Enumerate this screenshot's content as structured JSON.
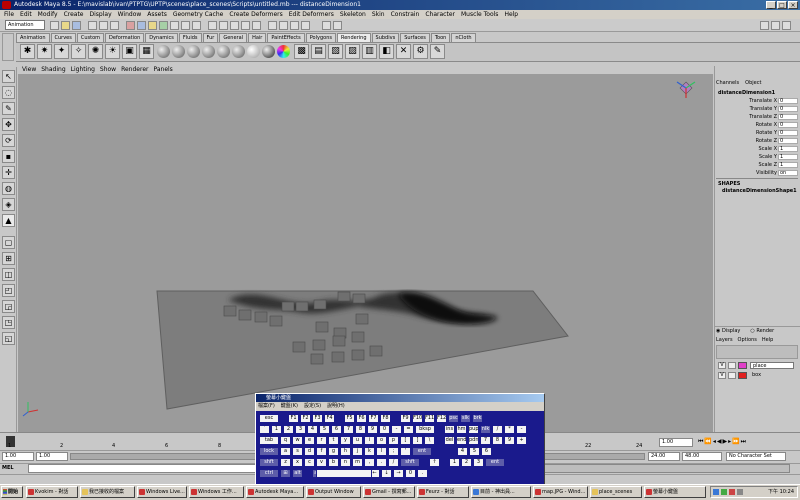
{
  "window": {
    "title": "Autodesk Maya 8.5 - E:\\mavislab\\ivan\\PTPTG\\UPTP\\scenes\\place_scenes\\Scripts\\untitled.mb  ---  distanceDimension1",
    "min": "_",
    "max": "□",
    "close": "×"
  },
  "menubar": [
    "File",
    "Edit",
    "Modify",
    "Create",
    "Display",
    "Window",
    "Assets",
    "Geometry Cache",
    "Create Deformers",
    "Edit Deformers",
    "Skeleton",
    "Skin",
    "Constrain",
    "Character",
    "Muscle Tools",
    "Help"
  ],
  "status_line": {
    "mode": "Animation"
  },
  "shelf": {
    "tabs": [
      "Animation",
      "Curves",
      "Custom",
      "Deformation",
      "Dynamics",
      "Fluids",
      "Fur",
      "General",
      "Hair",
      "PaintEffects",
      "Polygons",
      "Rendering",
      "Subdivs",
      "Surfaces",
      "Toon",
      "nCloth"
    ],
    "active_tab": "Rendering"
  },
  "panel_menu": [
    "View",
    "Shading",
    "Lighting",
    "Show",
    "Renderer",
    "Panels"
  ],
  "channel_box": {
    "tabs": [
      "Channels",
      "Object"
    ],
    "object": "distanceDimension1",
    "attributes": [
      {
        "label": "Translate X",
        "value": "0"
      },
      {
        "label": "Translate Y",
        "value": "0"
      },
      {
        "label": "Translate Z",
        "value": "0"
      },
      {
        "label": "Rotate X",
        "value": "0"
      },
      {
        "label": "Rotate Y",
        "value": "0"
      },
      {
        "label": "Rotate Z",
        "value": "0"
      },
      {
        "label": "Scale X",
        "value": "1"
      },
      {
        "label": "Scale Y",
        "value": "1"
      },
      {
        "label": "Scale Z",
        "value": "1"
      },
      {
        "label": "Visibility",
        "value": "on"
      }
    ],
    "shapes_header": "SHAPES",
    "shape_name": "distanceDimensionShape1"
  },
  "layer_editor": {
    "mode_display": "Display",
    "mode_render": "Render",
    "menu": [
      "Layers",
      "Options",
      "Help"
    ],
    "layers": [
      {
        "visible": "V",
        "name": "place",
        "color": "#e040c8"
      },
      {
        "visible": "V",
        "name": "box",
        "color": "#e02020"
      }
    ]
  },
  "time_slider": {
    "current_frame": "1.00",
    "tick_labels": [
      "1",
      "2",
      "4",
      "6",
      "8",
      "10",
      "12",
      "14",
      "16",
      "18",
      "20",
      "22",
      "24"
    ]
  },
  "range_slider": {
    "start": "1.00",
    "inner_start": "1.00",
    "inner_end": "24.00",
    "end": "48.00",
    "character_set": "No Character Set"
  },
  "command_line": {
    "label": "MEL"
  },
  "osk": {
    "title": "螢幕小鍵盤",
    "menu": [
      "檔案(F)",
      "鍵盤(K)",
      "設定(S)",
      "說明(H)"
    ],
    "rows": [
      [
        "esc",
        "",
        "F1",
        "F2",
        "F3",
        "F4",
        "",
        "F5",
        "F6",
        "F7",
        "F8",
        "",
        "F9",
        "F10",
        "F11",
        "F12",
        "psc",
        "slk",
        "brk"
      ],
      [
        "`",
        "1",
        "2",
        "3",
        "4",
        "5",
        "6",
        "7",
        "8",
        "9",
        "0",
        "-",
        "=",
        "bksp",
        "",
        "ins",
        "hm",
        "pup",
        "nlk",
        "/",
        "*",
        "-"
      ],
      [
        "tab",
        "q",
        "w",
        "e",
        "r",
        "t",
        "y",
        "u",
        "i",
        "o",
        "p",
        "[",
        "]",
        "\\",
        "",
        "del",
        "end",
        "pdn",
        "7",
        "8",
        "9",
        "+"
      ],
      [
        "lock",
        "a",
        "s",
        "d",
        "f",
        "g",
        "h",
        "j",
        "k",
        "l",
        ";",
        "'",
        "ent",
        "",
        "",
        "",
        "4",
        "5",
        "6"
      ],
      [
        "shft",
        "z",
        "x",
        "c",
        "v",
        "b",
        "n",
        "m",
        ",",
        ".",
        "/",
        "shft",
        "",
        "↑",
        "",
        "1",
        "2",
        "3",
        "ent"
      ],
      [
        "ctrl",
        "⊞",
        "alt",
        "",
        "alt",
        "⊞",
        "▤",
        "ctrl",
        "←",
        "↓",
        "→",
        "0",
        "."
      ]
    ]
  },
  "taskbar": {
    "start": "開始",
    "buttons": [
      "Kvokim - 對話",
      "我已接收的檔案",
      "Windows Live...",
      "Windows 工作...",
      "Autodesk Maya...",
      "Output Window",
      "Gmail - 撰寫郵...",
      "Feurz - 對話",
      "目前 - 神出員...",
      "map.JPG - Wind...",
      "place_scenes",
      "螢幕小鍵盤"
    ],
    "clock": "下午 10:24"
  }
}
